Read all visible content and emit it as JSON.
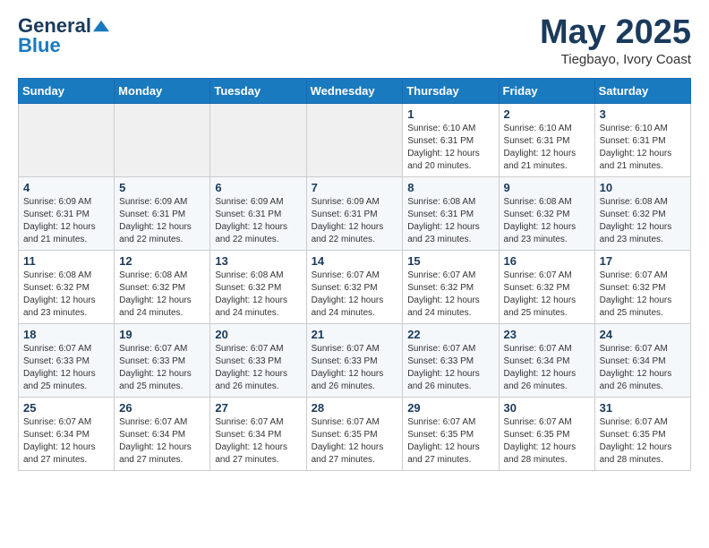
{
  "header": {
    "logo_general": "General",
    "logo_blue": "Blue",
    "month": "May 2025",
    "location": "Tiegbayo, Ivory Coast"
  },
  "days_of_week": [
    "Sunday",
    "Monday",
    "Tuesday",
    "Wednesday",
    "Thursday",
    "Friday",
    "Saturday"
  ],
  "weeks": [
    [
      {
        "day": "",
        "content": ""
      },
      {
        "day": "",
        "content": ""
      },
      {
        "day": "",
        "content": ""
      },
      {
        "day": "",
        "content": ""
      },
      {
        "day": "1",
        "content": "Sunrise: 6:10 AM\nSunset: 6:31 PM\nDaylight: 12 hours\nand 20 minutes."
      },
      {
        "day": "2",
        "content": "Sunrise: 6:10 AM\nSunset: 6:31 PM\nDaylight: 12 hours\nand 21 minutes."
      },
      {
        "day": "3",
        "content": "Sunrise: 6:10 AM\nSunset: 6:31 PM\nDaylight: 12 hours\nand 21 minutes."
      }
    ],
    [
      {
        "day": "4",
        "content": "Sunrise: 6:09 AM\nSunset: 6:31 PM\nDaylight: 12 hours\nand 21 minutes."
      },
      {
        "day": "5",
        "content": "Sunrise: 6:09 AM\nSunset: 6:31 PM\nDaylight: 12 hours\nand 22 minutes."
      },
      {
        "day": "6",
        "content": "Sunrise: 6:09 AM\nSunset: 6:31 PM\nDaylight: 12 hours\nand 22 minutes."
      },
      {
        "day": "7",
        "content": "Sunrise: 6:09 AM\nSunset: 6:31 PM\nDaylight: 12 hours\nand 22 minutes."
      },
      {
        "day": "8",
        "content": "Sunrise: 6:08 AM\nSunset: 6:31 PM\nDaylight: 12 hours\nand 23 minutes."
      },
      {
        "day": "9",
        "content": "Sunrise: 6:08 AM\nSunset: 6:32 PM\nDaylight: 12 hours\nand 23 minutes."
      },
      {
        "day": "10",
        "content": "Sunrise: 6:08 AM\nSunset: 6:32 PM\nDaylight: 12 hours\nand 23 minutes."
      }
    ],
    [
      {
        "day": "11",
        "content": "Sunrise: 6:08 AM\nSunset: 6:32 PM\nDaylight: 12 hours\nand 23 minutes."
      },
      {
        "day": "12",
        "content": "Sunrise: 6:08 AM\nSunset: 6:32 PM\nDaylight: 12 hours\nand 24 minutes."
      },
      {
        "day": "13",
        "content": "Sunrise: 6:08 AM\nSunset: 6:32 PM\nDaylight: 12 hours\nand 24 minutes."
      },
      {
        "day": "14",
        "content": "Sunrise: 6:07 AM\nSunset: 6:32 PM\nDaylight: 12 hours\nand 24 minutes."
      },
      {
        "day": "15",
        "content": "Sunrise: 6:07 AM\nSunset: 6:32 PM\nDaylight: 12 hours\nand 24 minutes."
      },
      {
        "day": "16",
        "content": "Sunrise: 6:07 AM\nSunset: 6:32 PM\nDaylight: 12 hours\nand 25 minutes."
      },
      {
        "day": "17",
        "content": "Sunrise: 6:07 AM\nSunset: 6:32 PM\nDaylight: 12 hours\nand 25 minutes."
      }
    ],
    [
      {
        "day": "18",
        "content": "Sunrise: 6:07 AM\nSunset: 6:33 PM\nDaylight: 12 hours\nand 25 minutes."
      },
      {
        "day": "19",
        "content": "Sunrise: 6:07 AM\nSunset: 6:33 PM\nDaylight: 12 hours\nand 25 minutes."
      },
      {
        "day": "20",
        "content": "Sunrise: 6:07 AM\nSunset: 6:33 PM\nDaylight: 12 hours\nand 26 minutes."
      },
      {
        "day": "21",
        "content": "Sunrise: 6:07 AM\nSunset: 6:33 PM\nDaylight: 12 hours\nand 26 minutes."
      },
      {
        "day": "22",
        "content": "Sunrise: 6:07 AM\nSunset: 6:33 PM\nDaylight: 12 hours\nand 26 minutes."
      },
      {
        "day": "23",
        "content": "Sunrise: 6:07 AM\nSunset: 6:34 PM\nDaylight: 12 hours\nand 26 minutes."
      },
      {
        "day": "24",
        "content": "Sunrise: 6:07 AM\nSunset: 6:34 PM\nDaylight: 12 hours\nand 26 minutes."
      }
    ],
    [
      {
        "day": "25",
        "content": "Sunrise: 6:07 AM\nSunset: 6:34 PM\nDaylight: 12 hours\nand 27 minutes."
      },
      {
        "day": "26",
        "content": "Sunrise: 6:07 AM\nSunset: 6:34 PM\nDaylight: 12 hours\nand 27 minutes."
      },
      {
        "day": "27",
        "content": "Sunrise: 6:07 AM\nSunset: 6:34 PM\nDaylight: 12 hours\nand 27 minutes."
      },
      {
        "day": "28",
        "content": "Sunrise: 6:07 AM\nSunset: 6:35 PM\nDaylight: 12 hours\nand 27 minutes."
      },
      {
        "day": "29",
        "content": "Sunrise: 6:07 AM\nSunset: 6:35 PM\nDaylight: 12 hours\nand 27 minutes."
      },
      {
        "day": "30",
        "content": "Sunrise: 6:07 AM\nSunset: 6:35 PM\nDaylight: 12 hours\nand 28 minutes."
      },
      {
        "day": "31",
        "content": "Sunrise: 6:07 AM\nSunset: 6:35 PM\nDaylight: 12 hours\nand 28 minutes."
      }
    ]
  ]
}
